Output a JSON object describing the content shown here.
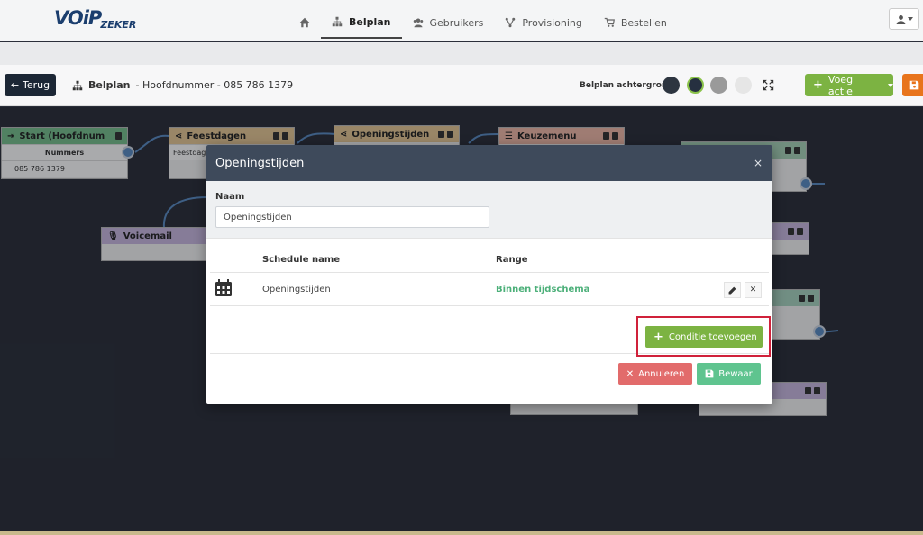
{
  "brand": {
    "logo_main": "VOiP",
    "logo_sub": "ZEKER"
  },
  "nav": {
    "items": [
      {
        "label": "",
        "icon": "home-icon"
      },
      {
        "label": "Belplan",
        "icon": "sitemap-icon",
        "active": true
      },
      {
        "label": "Gebruikers",
        "icon": "users-icon"
      },
      {
        "label": "Provisioning",
        "icon": "network-icon"
      },
      {
        "label": "Bestellen",
        "icon": "cart-icon"
      }
    ]
  },
  "toolbar": {
    "back_label": "Terug",
    "crumb_title": "Belplan",
    "crumb_detail": "- Hoofdnummer - 085 786 1379",
    "bg_label": "Belplan achtergrond",
    "add_action_label": "Voeg actie",
    "swatches": [
      "#2d3540",
      "#263040",
      "#9a9a9a",
      "#e6e6e6"
    ]
  },
  "canvas": {
    "nodes": [
      {
        "title": "Start (Hoofdnum",
        "color": "#78c08e",
        "row_header": "Nummers",
        "row_value": "085 786 1379"
      },
      {
        "title": "Feestdagen",
        "color": "#e6c896",
        "row_value": "Feestdagen"
      },
      {
        "title": "Openingstijden",
        "color": "#e6c896"
      },
      {
        "title": "Keuzemenu",
        "color": "#f0b9a8"
      },
      {
        "title": "Voicemail",
        "color": "#c9b8e0"
      }
    ]
  },
  "modal": {
    "title": "Openingstijden",
    "close": "×",
    "name_label": "Naam",
    "name_value": "Openingstijden",
    "table": {
      "headers": {
        "name": "Schedule name",
        "range": "Range"
      },
      "rows": [
        {
          "name": "Openingstijden",
          "range": "Binnen tijdschema"
        }
      ]
    },
    "add_condition_label": "Conditie toevoegen",
    "cancel_label": "Annuleren",
    "save_label": "Bewaar"
  },
  "colors": {
    "accent_green": "#7cb342",
    "danger": "#e26b6b",
    "success": "#5fc48f",
    "highlight": "#d0213a"
  }
}
